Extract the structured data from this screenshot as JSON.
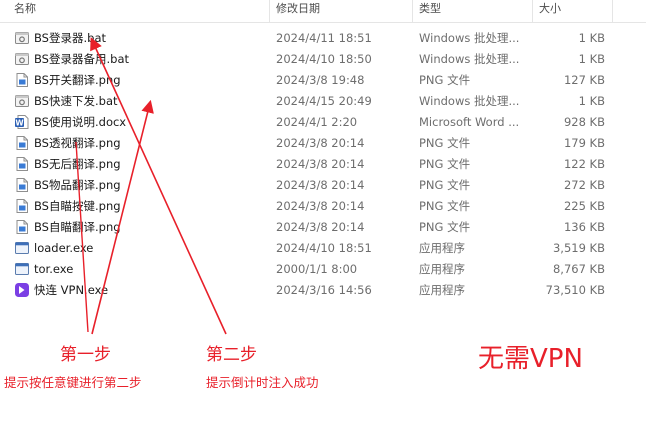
{
  "columns": {
    "name": "名称",
    "date": "修改日期",
    "type": "类型",
    "size": "大小"
  },
  "files": [
    {
      "name": "BS登录器.bat",
      "date": "2024/4/11 18:51",
      "type": "Windows 批处理...",
      "size": "1 KB",
      "icon": "bat-icon"
    },
    {
      "name": "BS登录器备用.bat",
      "date": "2024/4/10 18:50",
      "type": "Windows 批处理...",
      "size": "1 KB",
      "icon": "bat-icon"
    },
    {
      "name": "BS开关翻译.png",
      "date": "2024/3/8 19:48",
      "type": "PNG 文件",
      "size": "127 KB",
      "icon": "png-icon"
    },
    {
      "name": "BS快速下发.bat",
      "date": "2024/4/15 20:49",
      "type": "Windows 批处理...",
      "size": "1 KB",
      "icon": "bat-icon"
    },
    {
      "name": "BS使用说明.docx",
      "date": "2024/4/1 2:20",
      "type": "Microsoft Word ...",
      "size": "928 KB",
      "icon": "docx-icon"
    },
    {
      "name": "BS透视翻译.png",
      "date": "2024/3/8 20:14",
      "type": "PNG 文件",
      "size": "179 KB",
      "icon": "png-icon"
    },
    {
      "name": "BS无后翻译.png",
      "date": "2024/3/8 20:14",
      "type": "PNG 文件",
      "size": "122 KB",
      "icon": "png-icon"
    },
    {
      "name": "BS物品翻译.png",
      "date": "2024/3/8 20:14",
      "type": "PNG 文件",
      "size": "272 KB",
      "icon": "png-icon"
    },
    {
      "name": "BS自瞄按键.png",
      "date": "2024/3/8 20:14",
      "type": "PNG 文件",
      "size": "225 KB",
      "icon": "png-icon"
    },
    {
      "name": "BS自瞄翻译.png",
      "date": "2024/3/8 20:14",
      "type": "PNG 文件",
      "size": "136 KB",
      "icon": "png-icon"
    },
    {
      "name": "loader.exe",
      "date": "2024/4/10 18:51",
      "type": "应用程序",
      "size": "3,519 KB",
      "icon": "exe-icon"
    },
    {
      "name": "tor.exe",
      "date": "2000/1/1 8:00",
      "type": "应用程序",
      "size": "8,767 KB",
      "icon": "exe-icon"
    },
    {
      "name": "快连 VPN.exe",
      "date": "2024/3/16 14:56",
      "type": "应用程序",
      "size": "73,510 KB",
      "icon": "vpn-app-icon"
    }
  ],
  "annotations": {
    "step1_title": "第一步",
    "step1_desc": "提示按任意键进行第二步",
    "step2_title": "第二步",
    "step2_desc": "提示倒计时注入成功",
    "no_vpn": "无需VPN",
    "color": "#e8202a"
  }
}
